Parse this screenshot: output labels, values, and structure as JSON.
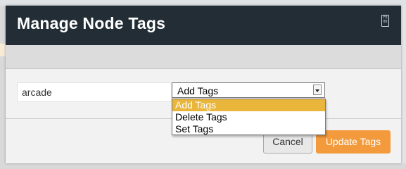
{
  "modal": {
    "title": "Manage Node Tags",
    "header_icon_text": "F0\n0D"
  },
  "form": {
    "tag_input_value": "arcade",
    "action_select": {
      "selected": "Add Tags",
      "options": [
        "Add Tags",
        "Delete Tags",
        "Set Tags"
      ]
    }
  },
  "footer": {
    "cancel_label": "Cancel",
    "update_label": "Update Tags"
  },
  "colors": {
    "header_bg": "#222d35",
    "primary_button": "#f39a3c",
    "dropdown_highlight": "#e9b63b"
  }
}
